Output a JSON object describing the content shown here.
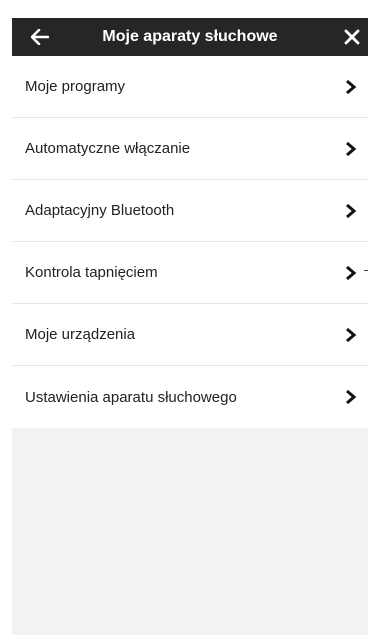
{
  "header": {
    "title": "Moje aparaty słuchowe",
    "back_icon": "arrow-left-icon",
    "close_icon": "close-icon"
  },
  "menu": {
    "items": [
      {
        "label": "Moje programy"
      },
      {
        "label": "Automatyczne włączanie"
      },
      {
        "label": "Adaptacyjny Bluetooth"
      },
      {
        "label": "Kontrola tapnięciem"
      },
      {
        "label": "Moje urządzenia"
      },
      {
        "label": "Ustawienia aparatu słuchowego"
      }
    ],
    "chevron_icon": "chevron-right-icon"
  },
  "colors": {
    "header_bg": "#262626",
    "page_bg": "#f2f2f2",
    "item_bg": "#ffffff",
    "divider": "#e6e6e6"
  }
}
